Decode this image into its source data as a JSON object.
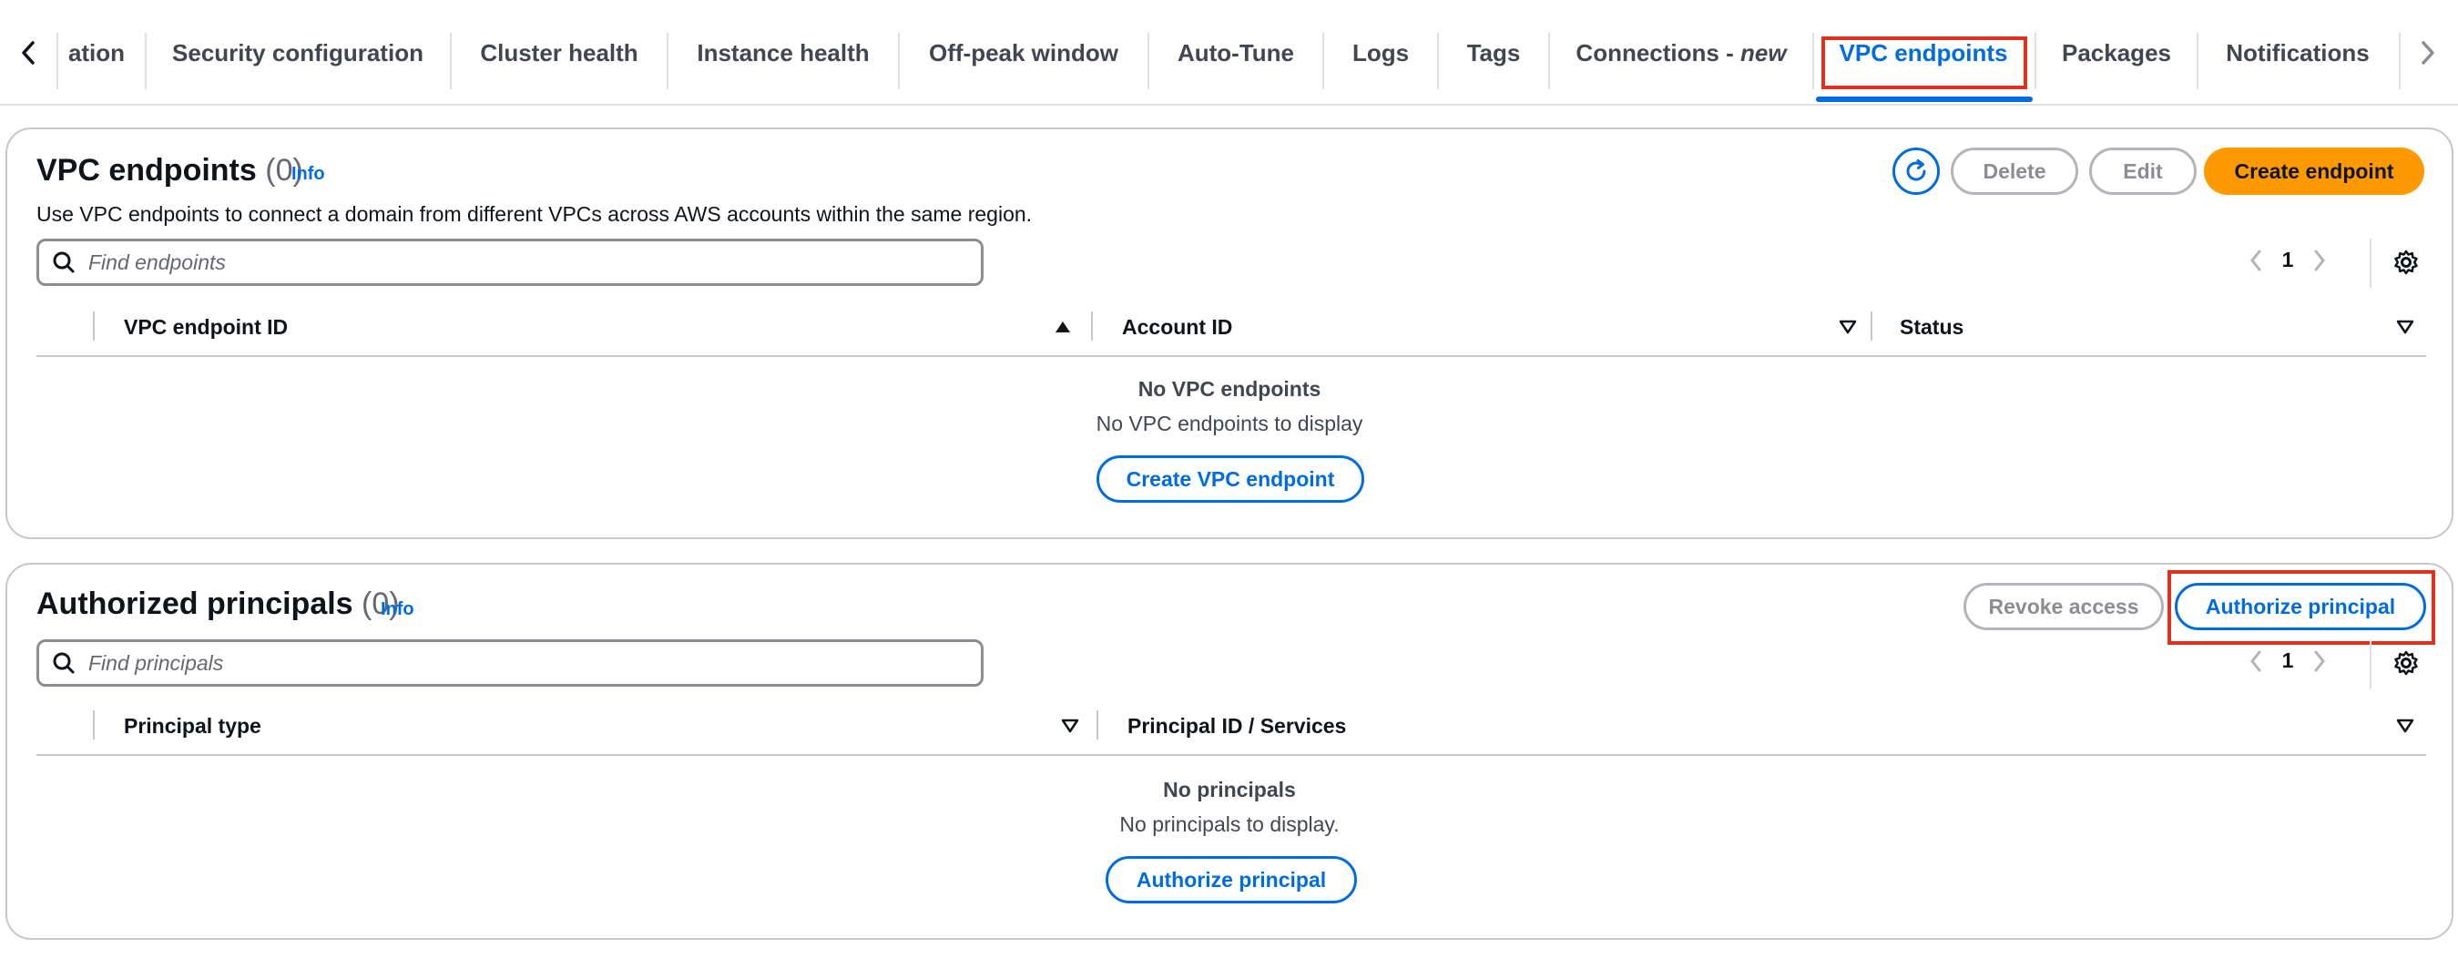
{
  "tabs": [
    {
      "label": "ation",
      "active": false
    },
    {
      "label": "Security configuration",
      "active": false
    },
    {
      "label": "Cluster health",
      "active": false
    },
    {
      "label": "Instance health",
      "active": false
    },
    {
      "label": "Off-peak window",
      "active": false
    },
    {
      "label": "Auto-Tune",
      "active": false
    },
    {
      "label": "Logs",
      "active": false
    },
    {
      "label": "Tags",
      "active": false
    },
    {
      "label": "Connections - ",
      "suffix": "new",
      "active": false
    },
    {
      "label": "VPC endpoints",
      "active": true
    },
    {
      "label": "Packages",
      "active": false
    },
    {
      "label": "Notifications",
      "active": false
    }
  ],
  "vpc": {
    "title": "VPC endpoints",
    "count": "(0)",
    "info": "Info",
    "description": "Use VPC endpoints to connect a domain from different VPCs across AWS accounts within the same region.",
    "delete_label": "Delete",
    "edit_label": "Edit",
    "create_label": "Create endpoint",
    "search_placeholder": "Find endpoints",
    "page": "1",
    "columns": [
      "VPC endpoint ID",
      "Account ID",
      "Status"
    ],
    "empty_title": "No VPC endpoints",
    "empty_sub": "No VPC endpoints to display",
    "empty_button": "Create VPC endpoint"
  },
  "principals": {
    "title": "Authorized principals",
    "count": "(0)",
    "info": "Info",
    "revoke_label": "Revoke access",
    "authorize_label": "Authorize principal",
    "search_placeholder": "Find principals",
    "page": "1",
    "columns": [
      "Principal type",
      "Principal ID / Services"
    ],
    "empty_title": "No principals",
    "empty_sub": "No principals to display.",
    "empty_button": "Authorize principal"
  },
  "colors": {
    "accent": "#006ce0",
    "primary_button": "#ff9900",
    "highlight": "#e0301e"
  }
}
